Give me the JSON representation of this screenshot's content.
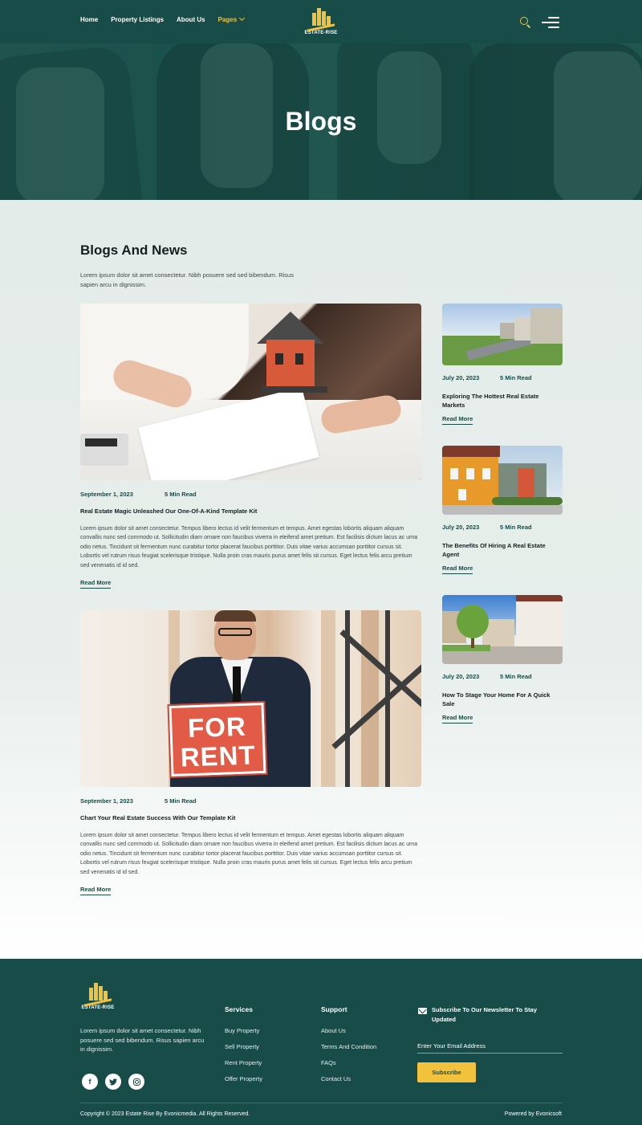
{
  "header": {
    "nav": [
      "Home",
      "Property Listings",
      "About Us",
      "Pages"
    ],
    "logo_text": "ESTATE-RISE"
  },
  "hero": {
    "title": "Blogs"
  },
  "section": {
    "title": "Blogs And News",
    "description": "Lorem ipsum dolor sit amet consectetur. Nibh posuere sed sed bibendum. Risus sapien arcu in dignissim."
  },
  "posts": [
    {
      "date": "September 1, 2023",
      "read_time": "5 Min Read",
      "title": "Real Estate Magic Unleashed Our One-Of-A-Kind Template Kit",
      "body": "Lorem ipsum dolor sit amet consectetur. Tempus libero lectus id velit fermentum et tempus. Amet egestas lobortis aliquam aliquam convallis nunc sed commodo ut. Sollicitudin diam ornare non faucibus viverra in eleifend amet pretium. Est facilisis dictum lacus ac urna odio netus. Tincidunt sit fermentum nunc curabitur tortor placerat faucibus porttitor. Duis vitae varius accumsan porttitor cursus sit. Lobortis vel rutrum risus feugiat scelerisque tristique. Nulla proin cras mauris purus amet felis sit cursus. Eget lectus felis arcu pretium sed venenatis id id sed.",
      "read_more": "Read More"
    },
    {
      "date": "September 1, 2023",
      "read_time": "5 Min Read",
      "title": "Chart Your Real Estate Success With Our Template Kit",
      "body": "Lorem ipsum dolor sit amet consectetur. Tempus libero lectus id velit fermentum et tempus. Amet egestas lobortis aliquam aliquam convallis nunc sed commodo ut. Sollicitudin diam ornare non faucibus viverra in eleifend amet pretium. Est facilisis dictum lacus ac urna odio netus. Tincidunt sit fermentum nunc curabitur tortor placerat faucibus porttitor. Duis vitae varius accumsan porttitor cursus sit. Lobortis vel rutrum risus feugiat scelerisque tristique. Nulla proin cras mauris purus amet felis sit cursus. Eget lectus felis arcu pretium sed venenatis id id sed.",
      "read_more": "Read More",
      "sign_line1": "FOR",
      "sign_line2": "RENT"
    }
  ],
  "sidebar": [
    {
      "date": "July 20, 2023",
      "read_time": "5 Min Read",
      "title": "Exploring The Hottest Real Estate Markets",
      "read_more": "Read More"
    },
    {
      "date": "July 20, 2023",
      "read_time": "5 Min Read",
      "title": "The Benefits Of Hiring A Real Estate Agent",
      "read_more": "Read More"
    },
    {
      "date": "July 20, 2023",
      "read_time": "5 Min Read",
      "title": "How To Stage Your Home For A Quick Sale",
      "read_more": "Read More"
    }
  ],
  "footer": {
    "logo_text": "ESTATE-RISE",
    "about": "Lorem ipsum dolor sit amet consectetur. Nibh posuere sed sed bibendum. Risus sapien arcu in dignissim.",
    "socials": [
      "facebook-icon",
      "twitter-icon",
      "instagram-icon"
    ],
    "services": {
      "title": "Services",
      "links": [
        "Buy Property",
        "Sell Property",
        "Rent Property",
        "Offer Property"
      ]
    },
    "support": {
      "title": "Support",
      "links": [
        "About Us",
        "Terms And Condition",
        "FAQs",
        "Contact Us"
      ]
    },
    "newsletter": {
      "title": "Subscribe To Our Newsletter To Stay Updated",
      "placeholder": "Enter Your Email Address",
      "button": "Subscribe"
    },
    "copyright": "Copyright © 2023 Estate Rise By Evonicmedia. All Rights Reserved.",
    "powered": "Powered by Evonicsoft"
  },
  "colors": {
    "primary": "#174c48",
    "accent": "#f2c23c",
    "background": "#e4ece9"
  }
}
